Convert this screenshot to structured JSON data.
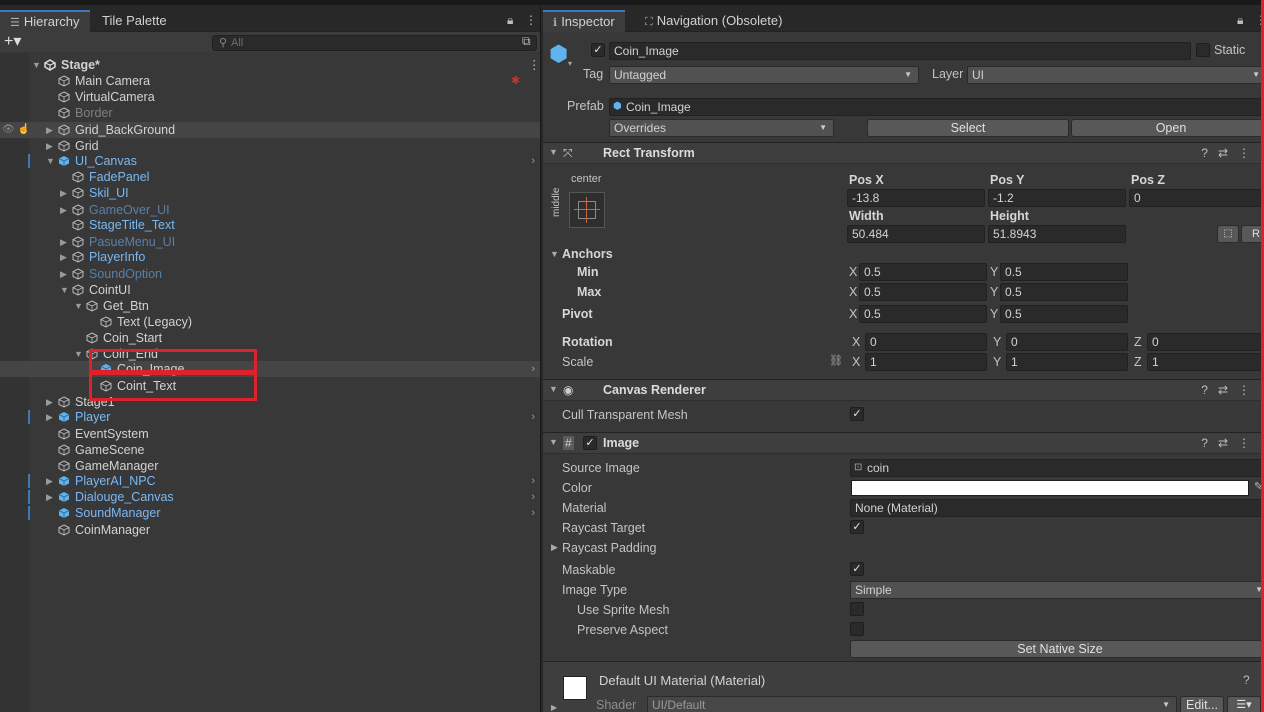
{
  "hierarchy": {
    "tabs": {
      "hierarchy": "Hierarchy",
      "tile_palette": "Tile Palette"
    },
    "search": {
      "placeholder": "All"
    },
    "rows": [
      {
        "label": "Stage*",
        "style": "normal"
      },
      {
        "label": "Main Camera",
        "style": "normal"
      },
      {
        "label": "VirtualCamera",
        "style": "normal"
      },
      {
        "label": "Border",
        "style": "disabled"
      },
      {
        "label": "Grid_BackGround",
        "style": "normal"
      },
      {
        "label": "Grid",
        "style": "normal"
      },
      {
        "label": "UI_Canvas",
        "style": "blue"
      },
      {
        "label": "FadePanel",
        "style": "blue"
      },
      {
        "label": "Skil_UI",
        "style": "blue"
      },
      {
        "label": "GameOver_UI",
        "style": "blue-dis"
      },
      {
        "label": "StageTitle_Text",
        "style": "blue"
      },
      {
        "label": "PasueMenu_UI",
        "style": "blue-dis"
      },
      {
        "label": "PlayerInfo",
        "style": "blue"
      },
      {
        "label": "SoundOption",
        "style": "blue-dis"
      },
      {
        "label": "CointUI",
        "style": "normal"
      },
      {
        "label": "Get_Btn",
        "style": "normal"
      },
      {
        "label": "Text (Legacy)",
        "style": "normal"
      },
      {
        "label": "Coin_Start",
        "style": "normal"
      },
      {
        "label": "Coin_End",
        "style": "normal"
      },
      {
        "label": "Coin_Image",
        "style": "normal"
      },
      {
        "label": "Coint_Text",
        "style": "normal"
      },
      {
        "label": "Stage1",
        "style": "normal"
      },
      {
        "label": "Player",
        "style": "blue"
      },
      {
        "label": "EventSystem",
        "style": "normal"
      },
      {
        "label": "GameScene",
        "style": "normal"
      },
      {
        "label": "GameManager",
        "style": "normal"
      },
      {
        "label": "PlayerAI_NPC",
        "style": "blue"
      },
      {
        "label": "Dialouge_Canvas",
        "style": "blue"
      },
      {
        "label": "SoundManager",
        "style": "blue"
      },
      {
        "label": "CoinManager",
        "style": "normal"
      }
    ]
  },
  "inspector": {
    "tabs": {
      "inspector": "Inspector",
      "navigation": "Navigation (Obsolete)"
    },
    "object": {
      "name": "Coin_Image",
      "static_label": "Static"
    },
    "tag": {
      "label": "Tag",
      "value": "Untagged"
    },
    "layer": {
      "label": "Layer",
      "value": "UI"
    },
    "prefab": {
      "label": "Prefab",
      "value": "Coin_Image",
      "overrides": "Overrides",
      "select": "Select",
      "open": "Open"
    },
    "rect_transform": {
      "title": "Rect Transform",
      "anchor_h": "center",
      "anchor_v": "middle",
      "pos_x_label": "Pos X",
      "pos_x": "-13.8",
      "pos_y_label": "Pos Y",
      "pos_y": "-1.2",
      "pos_z_label": "Pos Z",
      "pos_z": "0",
      "width_label": "Width",
      "width": "50.484",
      "height_label": "Height",
      "height": "51.8943",
      "r_button": "R",
      "anchors_label": "Anchors",
      "min_label": "Min",
      "min_x": "0.5",
      "min_y": "0.5",
      "max_label": "Max",
      "max_x": "0.5",
      "max_y": "0.5",
      "pivot_label": "Pivot",
      "pivot_x": "0.5",
      "pivot_y": "0.5",
      "rotation_label": "Rotation",
      "rot_x": "0",
      "rot_y": "0",
      "rot_z": "0",
      "scale_label": "Scale",
      "scale_x": "1",
      "scale_y": "1",
      "scale_z": "1",
      "x": "X",
      "y": "Y",
      "z": "Z"
    },
    "canvas_renderer": {
      "title": "Canvas Renderer",
      "cull_label": "Cull Transparent Mesh"
    },
    "image": {
      "title": "Image",
      "source_image_label": "Source Image",
      "source_image": "coin",
      "color_label": "Color",
      "material_label": "Material",
      "material": "None (Material)",
      "raycast_target_label": "Raycast Target",
      "raycast_padding_label": "Raycast Padding",
      "maskable_label": "Maskable",
      "image_type_label": "Image Type",
      "image_type": "Simple",
      "use_sprite_mesh_label": "Use Sprite Mesh",
      "preserve_aspect_label": "Preserve Aspect",
      "set_native_size": "Set Native Size"
    },
    "material_footer": {
      "title": "Default UI Material (Material)",
      "shader_label": "Shader",
      "shader_value": "UI/Default",
      "edit": "Edit..."
    }
  },
  "colors": {
    "accent": "#3a79bb",
    "highlight": "#e0202a",
    "prefab_blue": "#7ab8f5"
  }
}
